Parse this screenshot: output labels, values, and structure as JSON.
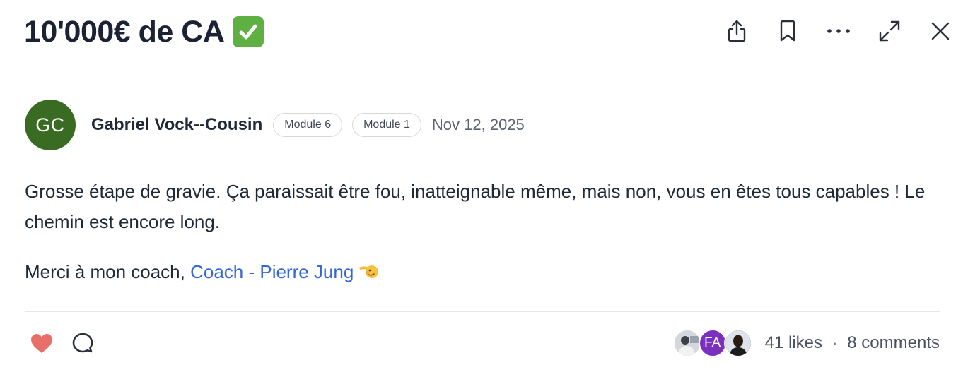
{
  "post": {
    "title": "10'000€ de CA",
    "title_emoji": "check-mark-emoji",
    "author": {
      "initials": "GC",
      "name": "Gabriel Vock--Cousin",
      "avatar_color": "#3a6b22"
    },
    "tags": [
      "Module 6",
      "Module 1"
    ],
    "date": "Nov 12, 2025",
    "body": {
      "paragraph_1": "Grosse étape de gravie. Ça paraissait être fou, inatteignable même, mais non, vous en êtes tous capables ! Le chemin est encore long.",
      "paragraph_2_prefix": "Merci à mon coach, ",
      "mention": "Coach - Pierre Jung",
      "trailing_emoji": "pointing-hand-emoji"
    }
  },
  "toolbar": {
    "icons": [
      "share-icon",
      "bookmark-icon",
      "more-icon",
      "expand-icon",
      "close-icon"
    ]
  },
  "footer": {
    "likers": [
      {
        "type": "photo"
      },
      {
        "type": "initials",
        "initials": "FA",
        "color": "#7b2fbf"
      },
      {
        "type": "photo"
      }
    ],
    "likes_text": "41 likes",
    "separator": "·",
    "comments_text": "8 comments",
    "like_color": "#e8706a",
    "mention_color": "#3466d6"
  }
}
